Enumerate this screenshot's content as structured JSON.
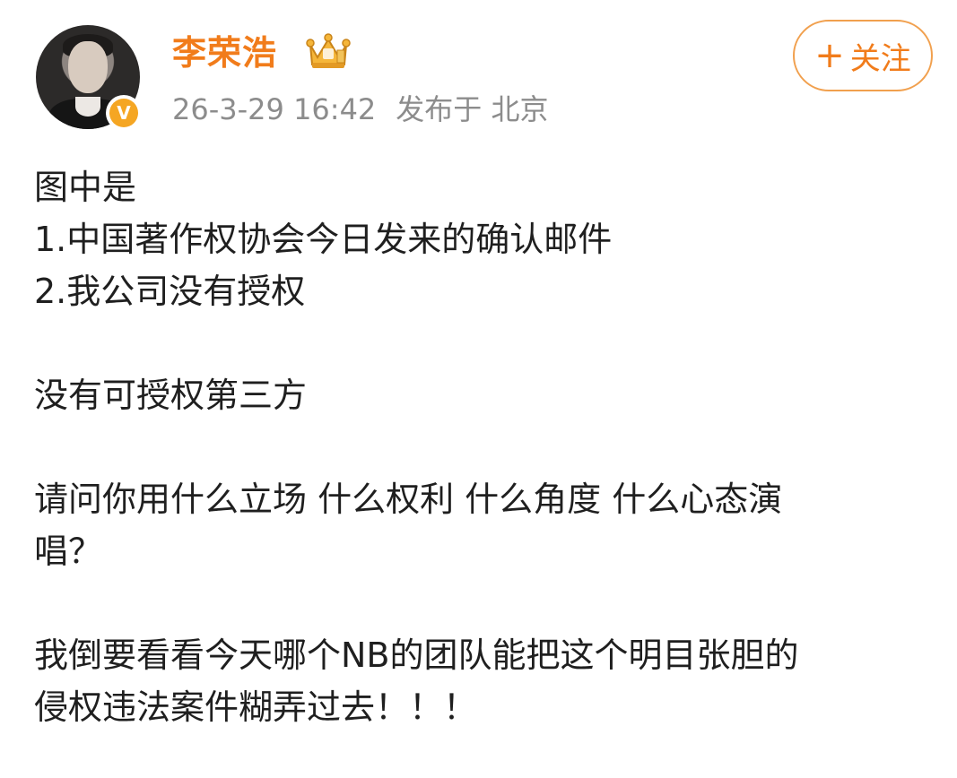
{
  "author": {
    "name": "李荣浩",
    "verified_badge": "V",
    "crown_icon": "crown-icon",
    "accent_color": "#f17c1b"
  },
  "meta": {
    "timestamp": "26-3-29 16:42",
    "location": "发布于 北京"
  },
  "follow_button": {
    "plus": "+",
    "label": "关注"
  },
  "post": {
    "lines": [
      "图中是",
      "1.中国著作权协会今日发来的确认邮件",
      "2.我公司没有授权",
      "没有可授权第三方",
      "请问你用什么立场 什么权利 什么角度 什么心态演",
      "唱？",
      "我倒要看看今天哪个NB的团队能把这个明目张胆的",
      "侵权违法案件糊弄过去！！！"
    ]
  }
}
